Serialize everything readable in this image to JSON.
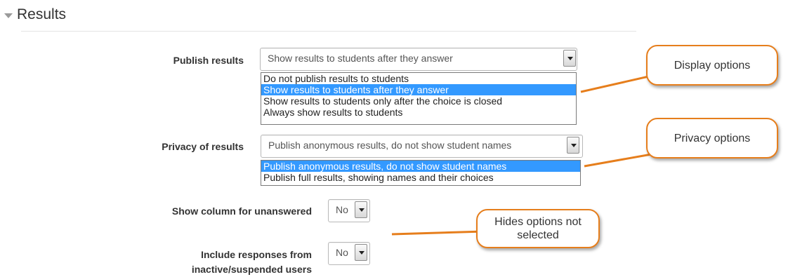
{
  "section": {
    "title": "Results"
  },
  "publish_results": {
    "label": "Publish results",
    "selected": "Show results to students after they answer",
    "options": [
      "Do not publish results to students",
      "Show results to students after they answer",
      "Show results to students only after the choice is closed",
      "Always show results to students"
    ],
    "selected_index": 1
  },
  "privacy_results": {
    "label": "Privacy of results",
    "selected": "Publish anonymous results, do not show student names",
    "options": [
      "Publish anonymous results, do not show student names",
      "Publish full results, showing names and their choices"
    ],
    "selected_index": 0
  },
  "show_unanswered": {
    "label": "Show column for unanswered",
    "selected": "No"
  },
  "include_inactive": {
    "label_line1": "Include responses from",
    "label_line2": "inactive/suspended users",
    "selected": "No"
  },
  "callouts": {
    "display": "Display options",
    "privacy": "Privacy options",
    "hides_line1": "Hides options not",
    "hides_line2": "selected"
  },
  "colors": {
    "callout_border": "#e67e1c",
    "highlight": "#3399ff"
  }
}
